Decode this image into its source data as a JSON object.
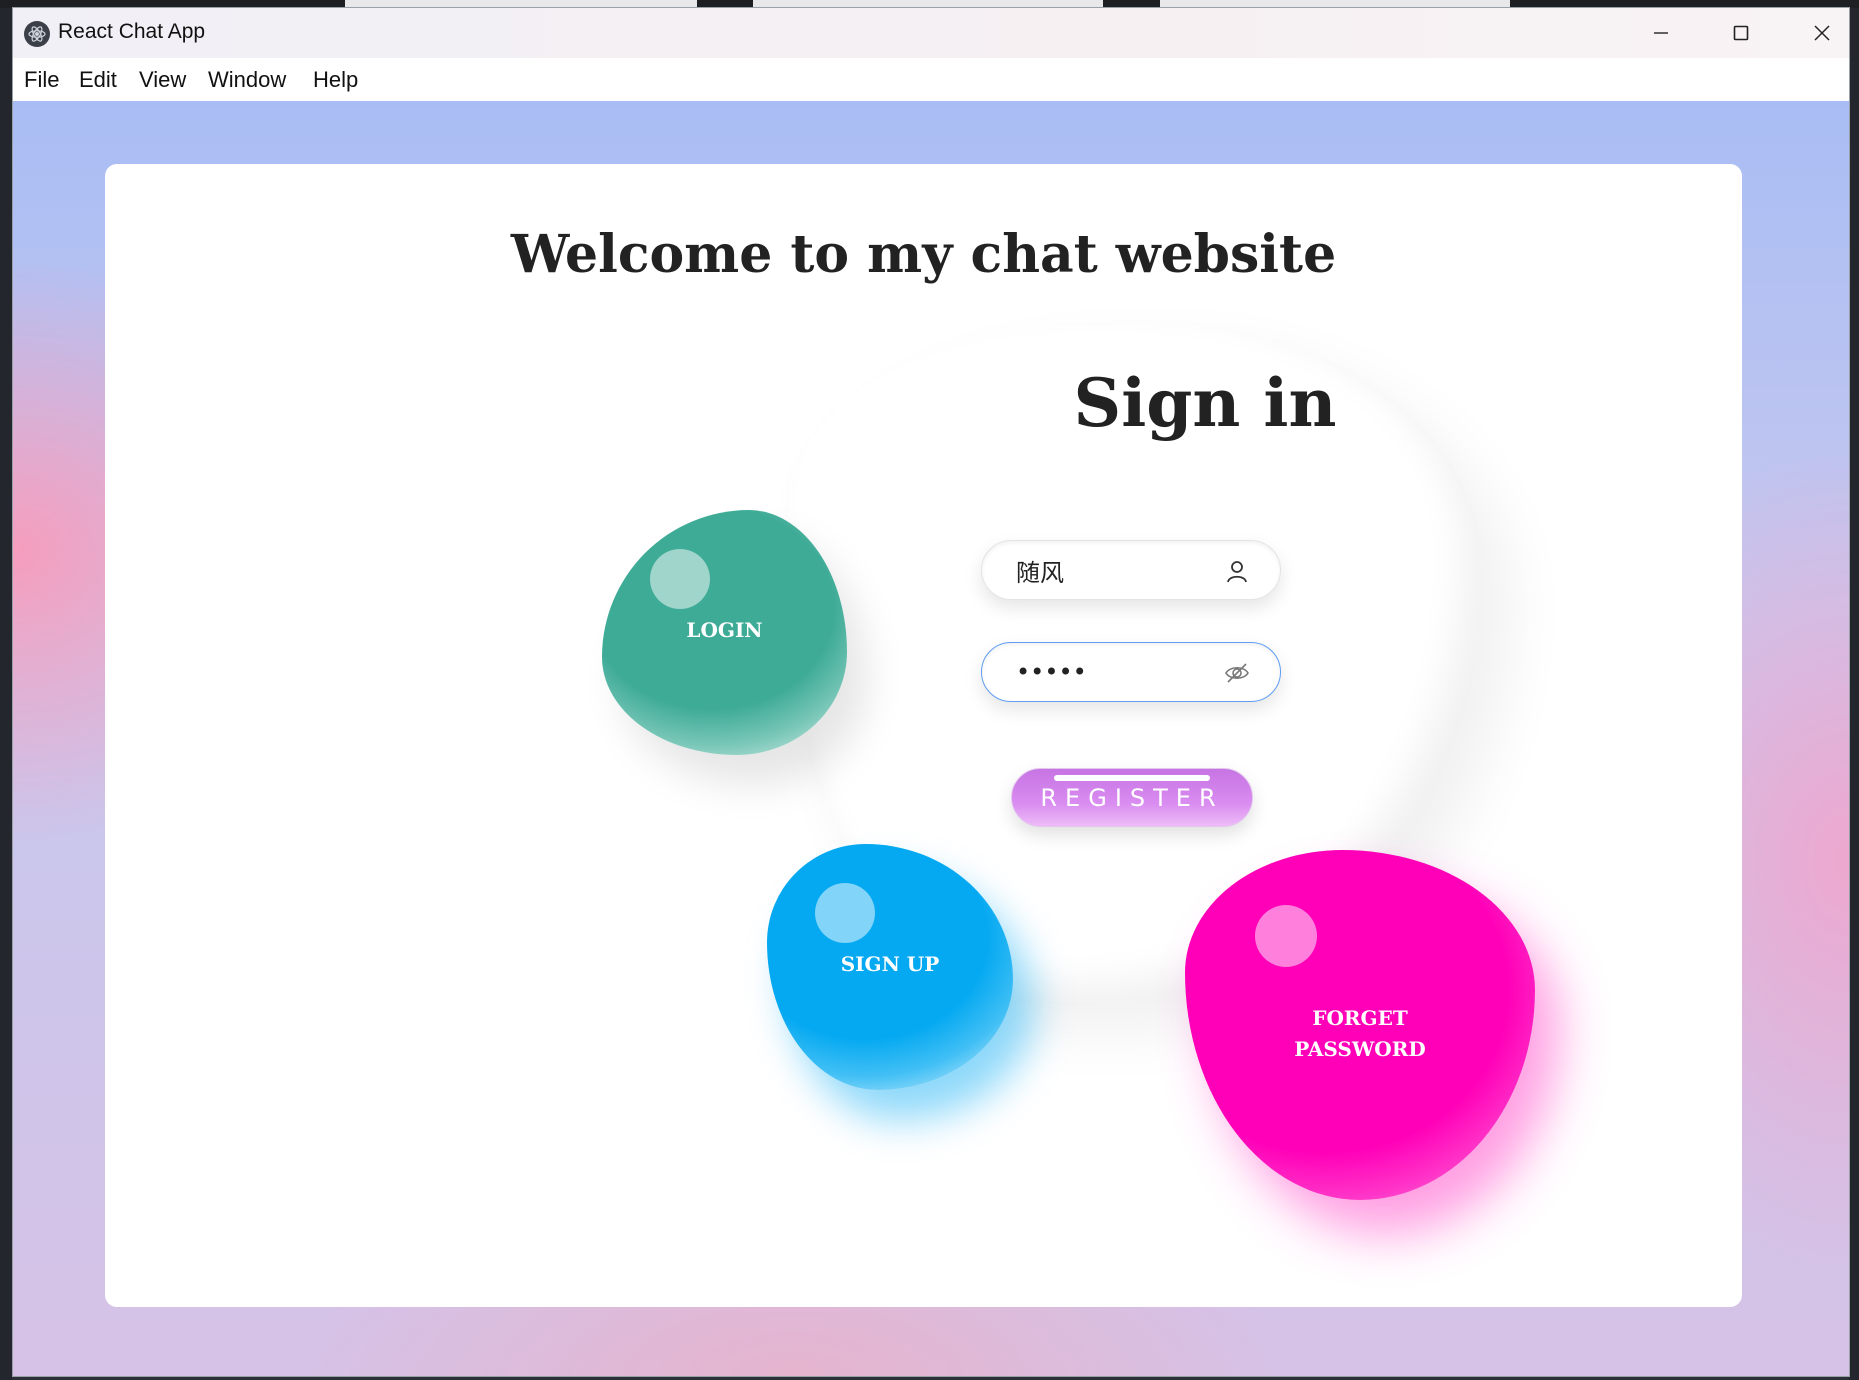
{
  "window": {
    "title": "React Chat App",
    "controls": {
      "minimize": "minimize",
      "maximize": "maximize",
      "close": "close"
    }
  },
  "menubar": {
    "items": [
      "File",
      "Edit",
      "View",
      "Window",
      "Help"
    ]
  },
  "page": {
    "heading": "Welcome to my chat website",
    "form_title": "Sign in",
    "username": {
      "value": "随风",
      "icon": "user-icon"
    },
    "password": {
      "value": "*****",
      "icon": "eye-off-icon"
    },
    "register_label": "REGISTER",
    "bubbles": {
      "login": "LOGIN",
      "signup": "SIGN UP",
      "forget_line1": "FORGET",
      "forget_line2": "PASSWORD"
    }
  },
  "colors": {
    "login_bubble": "#3eab97",
    "signup_bubble": "#05a9f1",
    "forget_bubble": "#ff00b8",
    "register_button": "#d98cf0",
    "focus_border": "#5f9ef2"
  }
}
